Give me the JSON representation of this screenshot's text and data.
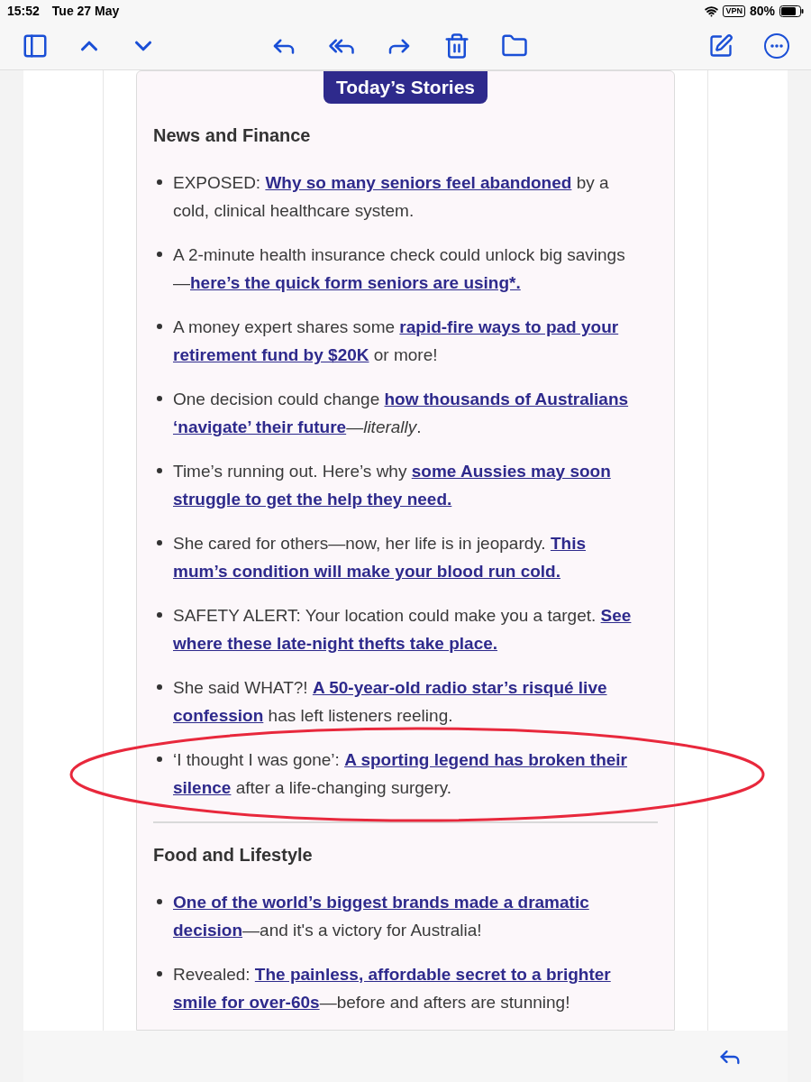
{
  "status_bar": {
    "time": "15:52",
    "date": "Tue 27 May",
    "vpn": "VPN",
    "battery": "80%"
  },
  "banner": "Today’s Stories",
  "sections": [
    {
      "heading": "News and Finance",
      "items": [
        {
          "circled": false,
          "segments": [
            {
              "kind": "text",
              "text": "EXPOSED: "
            },
            {
              "kind": "link",
              "text": "Why so many seniors feel abandoned"
            },
            {
              "kind": "text",
              "text": " by a cold, clinical healthcare system."
            }
          ]
        },
        {
          "circled": false,
          "segments": [
            {
              "kind": "text",
              "text": "A 2-minute health insurance check could unlock big savings —"
            },
            {
              "kind": "link",
              "text": "here’s the quick form seniors are using*."
            }
          ]
        },
        {
          "circled": false,
          "segments": [
            {
              "kind": "text",
              "text": "A money expert shares some "
            },
            {
              "kind": "link",
              "text": "rapid-fire ways to pad your"
            },
            {
              "kind": "space"
            },
            {
              "kind": "link",
              "text": "retirement fund by $20K"
            },
            {
              "kind": "text",
              "text": " or more!"
            }
          ]
        },
        {
          "circled": false,
          "segments": [
            {
              "kind": "text",
              "text": "One decision could change "
            },
            {
              "kind": "link",
              "text": "how thousands of Australians"
            },
            {
              "kind": "space"
            },
            {
              "kind": "link",
              "text": "‘navigate’ their future"
            },
            {
              "kind": "text",
              "text": "—"
            },
            {
              "kind": "italic",
              "text": "literally"
            },
            {
              "kind": "text",
              "text": "."
            }
          ]
        },
        {
          "circled": false,
          "segments": [
            {
              "kind": "text",
              "text": "Time’s running out. Here’s why "
            },
            {
              "kind": "link",
              "text": "some Aussies may soon"
            },
            {
              "kind": "space"
            },
            {
              "kind": "link",
              "text": "struggle to get the help they need."
            }
          ]
        },
        {
          "circled": false,
          "segments": [
            {
              "kind": "text",
              "text": "She cared for others—now, her life is in jeopardy. "
            },
            {
              "kind": "link",
              "text": "This"
            },
            {
              "kind": "space"
            },
            {
              "kind": "link",
              "text": "mum’s condition will make your blood run cold."
            }
          ]
        },
        {
          "circled": false,
          "segments": [
            {
              "kind": "text",
              "text": "SAFETY ALERT: Your location could make you a target. "
            },
            {
              "kind": "link",
              "text": "See"
            },
            {
              "kind": "space"
            },
            {
              "kind": "link",
              "text": "where these late-night thefts take place."
            }
          ]
        },
        {
          "circled": false,
          "segments": [
            {
              "kind": "text",
              "text": "She said WHAT?! "
            },
            {
              "kind": "link",
              "text": "A 50-year-old radio star’s risqué live"
            },
            {
              "kind": "space"
            },
            {
              "kind": "link",
              "text": "confession"
            },
            {
              "kind": "text",
              "text": " has left listeners reeling."
            }
          ]
        },
        {
          "circled": true,
          "segments": [
            {
              "kind": "text",
              "text": "‘I thought I was gone’: "
            },
            {
              "kind": "link",
              "text": "A sporting legend has broken their"
            },
            {
              "kind": "space"
            },
            {
              "kind": "link",
              "text": "silence"
            },
            {
              "kind": "text",
              "text": " after a life-changing surgery."
            }
          ]
        }
      ]
    },
    {
      "heading": "Food and Lifestyle",
      "items": [
        {
          "circled": false,
          "segments": [
            {
              "kind": "link",
              "text": "One of the world’s biggest brands made a dramatic"
            },
            {
              "kind": "space"
            },
            {
              "kind": "link",
              "text": "decision"
            },
            {
              "kind": "text",
              "text": "—and it's a victory for Australia!"
            }
          ]
        },
        {
          "circled": false,
          "segments": [
            {
              "kind": "text",
              "text": "Revealed: "
            },
            {
              "kind": "link",
              "text": "The painless, affordable secret to a brighter"
            },
            {
              "kind": "space"
            },
            {
              "kind": "link",
              "text": "smile for over-60s"
            },
            {
              "kind": "text",
              "text": "—before and afters are stunning!"
            }
          ]
        }
      ]
    }
  ]
}
